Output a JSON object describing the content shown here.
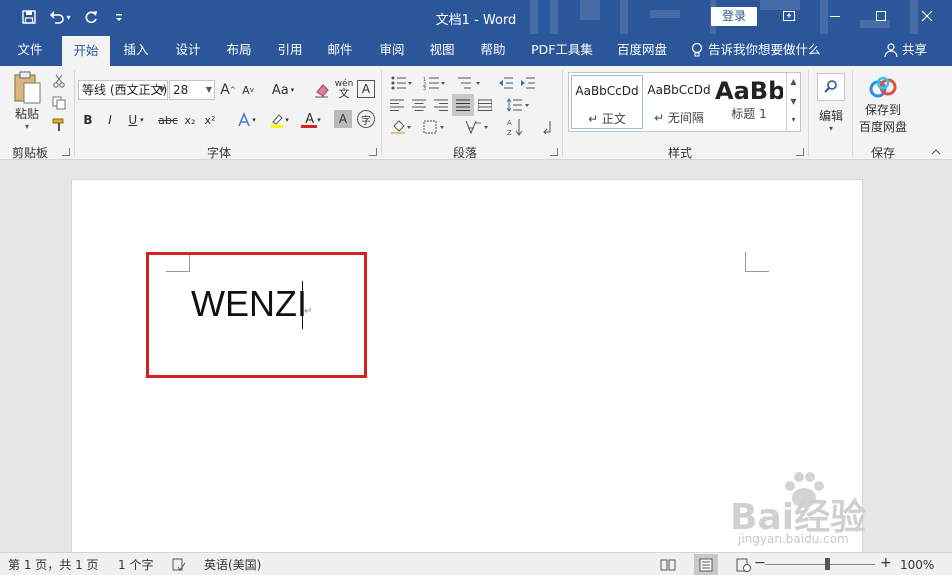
{
  "titlebar": {
    "title": "文档1  -  Word",
    "login_label": "登录"
  },
  "tabs": [
    {
      "label": "文件"
    },
    {
      "label": "开始"
    },
    {
      "label": "插入"
    },
    {
      "label": "设计"
    },
    {
      "label": "布局"
    },
    {
      "label": "引用"
    },
    {
      "label": "邮件"
    },
    {
      "label": "审阅"
    },
    {
      "label": "视图"
    },
    {
      "label": "帮助"
    },
    {
      "label": "PDF工具集"
    },
    {
      "label": "百度网盘"
    }
  ],
  "tell_me": "告诉我你想要做什么",
  "share_label": "共享",
  "ribbon": {
    "clipboard": {
      "paste_label": "粘贴",
      "group_label": "剪贴板"
    },
    "font": {
      "font_name": "等线 (西文正文)",
      "font_size": "28",
      "group_label": "字体",
      "grow_label": "A",
      "shrink_label": "A",
      "case_label": "Aa",
      "bold": "B",
      "italic": "I",
      "underline": "U",
      "strike": "abc",
      "sub": "x₂",
      "sup": "x²",
      "font_color_label": "A",
      "wen_label": "wén",
      "border_char": "A",
      "circle_char": "字"
    },
    "paragraph": {
      "group_label": "段落"
    },
    "styles": {
      "group_label": "样式",
      "items": [
        {
          "sample": "AaBbCcDd",
          "name": "↵ 正文"
        },
        {
          "sample": "AaBbCcDd",
          "name": "↵ 无间隔"
        },
        {
          "sample": "AaBb",
          "name": "标题 1"
        }
      ]
    },
    "editing": {
      "label": "编辑"
    },
    "save": {
      "line1": "保存到",
      "line2": "百度网盘",
      "group_label": "保存"
    }
  },
  "document": {
    "text": "WENZI"
  },
  "watermark": {
    "main": "Bai经验",
    "sub": "jingyan.baidu.com"
  },
  "statusbar": {
    "page": "第 1 页，共 1 页",
    "words": "1 个字",
    "language": "英语(美国)",
    "zoom": "100%"
  },
  "colors": {
    "brand": "#2b579a",
    "highlight": "#d32020"
  }
}
